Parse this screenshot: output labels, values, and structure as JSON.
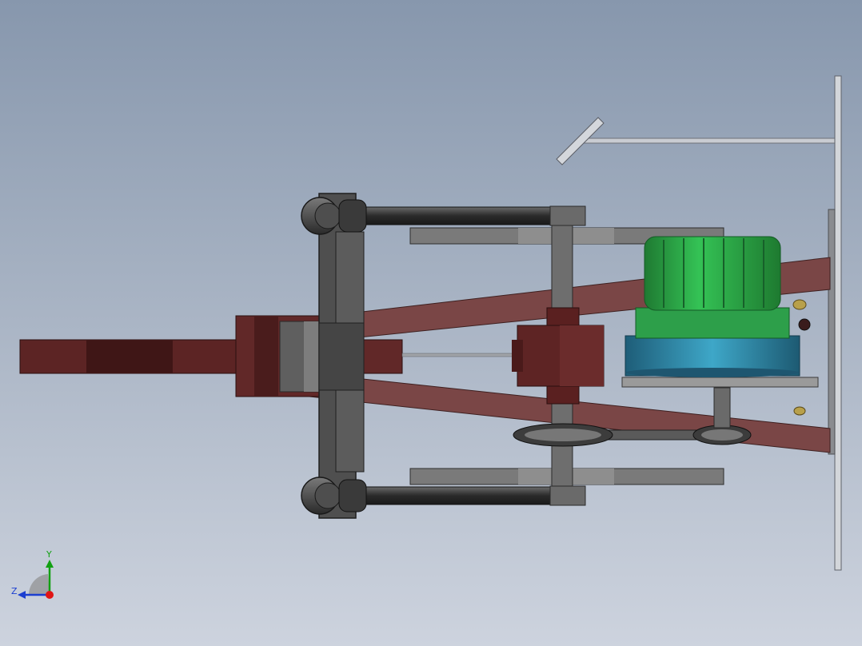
{
  "triad": {
    "y_label": "Y",
    "z_label": "Z",
    "colors": {
      "y": "#12a012",
      "z": "#1c3fd0",
      "x": "#e01414"
    }
  },
  "colors": {
    "background_top": "#8797ad",
    "background_bottom": "#cdd3de",
    "frame_maroon": "#6e3c3c",
    "plate_gray": "#4b4b4b",
    "motor_green": "#27a84a",
    "motor_teal": "#2a85a3"
  }
}
